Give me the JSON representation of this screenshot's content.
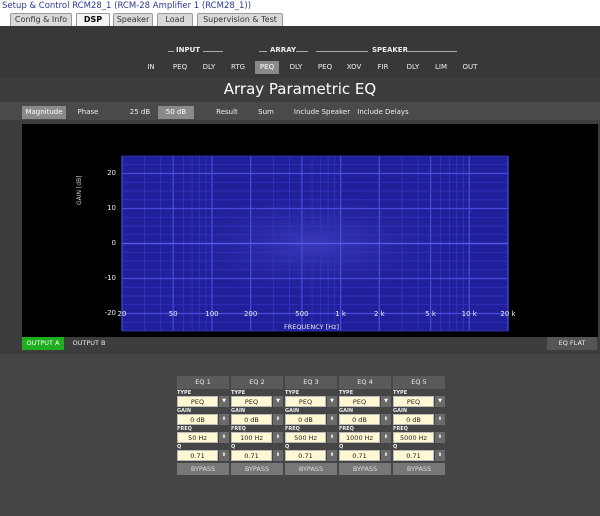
{
  "window": {
    "title": "Setup & Control RCM28_1 (RCM-28 Amplifier 1 (RCM28_1))"
  },
  "tabs": [
    "Config & Info",
    "DSP",
    "Speaker",
    "Load",
    "Supervision & Test"
  ],
  "active_tab": "DSP",
  "groups": {
    "input": "INPUT",
    "array": "ARRAY",
    "speaker": "SPEAKER"
  },
  "subnav": [
    "IN",
    "PEQ",
    "DLY",
    "RTG",
    "PEQ",
    "DLY",
    "PEQ",
    "XOV",
    "FIR",
    "DLY",
    "LIM",
    "OUT"
  ],
  "active_subnav_index": 4,
  "page_title": "Array Parametric EQ",
  "toolbar": {
    "magnitude": "Magnitude",
    "phase": "Phase",
    "range_25": "25 dB",
    "range_50": "50 dB",
    "result": "Result",
    "sum": "Sum",
    "include_speaker": "Include Speaker",
    "include_delays": "Include Delays"
  },
  "chart_data": {
    "type": "line",
    "title": "",
    "xlabel": "FREQUENCY [Hz]",
    "ylabel": "GAIN [dB]",
    "x_scale": "log",
    "xlim": [
      20,
      20000
    ],
    "ylim": [
      -25,
      25
    ],
    "x_ticks": [
      "20",
      "50",
      "100",
      "200",
      "500",
      "1 k",
      "2 k",
      "5 k",
      "10 k",
      "20 k"
    ],
    "y_ticks": [
      "20",
      "10",
      "0",
      "-10",
      "-20"
    ],
    "grid": true,
    "series": [
      {
        "values": [
          0,
          0
        ]
      }
    ]
  },
  "outputs": {
    "a": "OUTPUT A",
    "b": "OUTPUT B"
  },
  "eq_flat": "EQ FLAT",
  "eq_labels": {
    "type": "TYPE",
    "gain": "GAIN",
    "freq": "FREQ",
    "q": "Q",
    "bypass": "BYPASS"
  },
  "eq_bands": [
    {
      "name": "EQ 1",
      "type": "PEQ",
      "gain": "0 dB",
      "freq": "50 Hz",
      "q": "0.71"
    },
    {
      "name": "EQ 2",
      "type": "PEQ",
      "gain": "0 dB",
      "freq": "100 Hz",
      "q": "0.71"
    },
    {
      "name": "EQ 3",
      "type": "PEQ",
      "gain": "0 dB",
      "freq": "500 Hz",
      "q": "0.71"
    },
    {
      "name": "EQ 4",
      "type": "PEQ",
      "gain": "0 dB",
      "freq": "1000 Hz",
      "q": "0.71"
    },
    {
      "name": "EQ 5",
      "type": "PEQ",
      "gain": "0 dB",
      "freq": "5000 Hz",
      "q": "0.71"
    }
  ],
  "colors": {
    "plot_bg": "#000000",
    "grid_area": "#20209a",
    "accent_green": "#1fae1f"
  }
}
